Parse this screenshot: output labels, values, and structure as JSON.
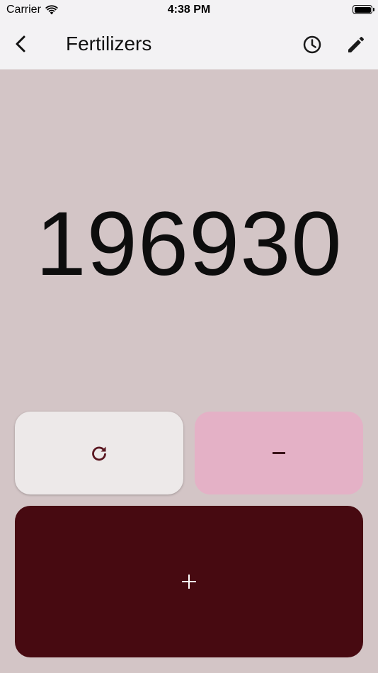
{
  "status_bar": {
    "carrier": "Carrier",
    "time": "4:38 PM",
    "icons": [
      "wifi-icon",
      "battery-icon"
    ]
  },
  "nav_bar": {
    "title": "Fertilizers",
    "icons": [
      "chevron-left-icon",
      "clock-icon",
      "pencil-icon"
    ]
  },
  "counter": {
    "value": "196930"
  },
  "buttons": {
    "reset_icon": "refresh-icon",
    "decrement_label": "–",
    "increment_label": "+"
  },
  "colors": {
    "background": "#d3c5c6",
    "bar_background": "#f3f2f4",
    "reset_button": "#ede9e9",
    "decrement_button": "#e4b1c6",
    "increment_button": "#470a11",
    "accent": "#5a1620"
  }
}
